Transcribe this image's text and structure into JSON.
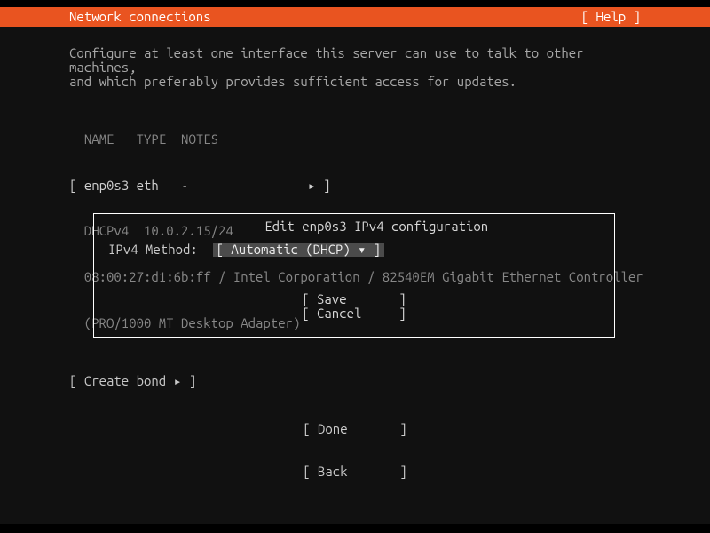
{
  "header": {
    "title": "Network connections",
    "help": "[ Help ]"
  },
  "instructions": "Configure at least one interface this server can use to talk to other machines,\nand which preferably provides sufficient access for updates.",
  "iface": {
    "columns": {
      "name": "NAME",
      "type": "TYPE",
      "notes": "NOTES"
    },
    "row": {
      "open": "[",
      "name": "enp0s3",
      "type": "eth",
      "notes": "-",
      "arrow": "▸",
      "close": "]"
    },
    "dhcp_line": "  DHCPv4  10.0.2.15/24",
    "mac_line": "  08:00:27:d1:6b:ff / Intel Corporation / 82540EM Gigabit Ethernet Controller",
    "model_line": "  (PRO/1000 MT Desktop Adapter)"
  },
  "create_bond": "[ Create bond ▸ ]",
  "dialog": {
    "title": "Edit enp0s3 IPv4 configuration",
    "method_label": "IPv4 Method:  ",
    "dropdown": "[ Automatic (DHCP) ▾ ]",
    "save": "[ Save       ]",
    "cancel": "[ Cancel     ]"
  },
  "footer": {
    "done": "[ Done       ]",
    "back": "[ Back       ]"
  }
}
